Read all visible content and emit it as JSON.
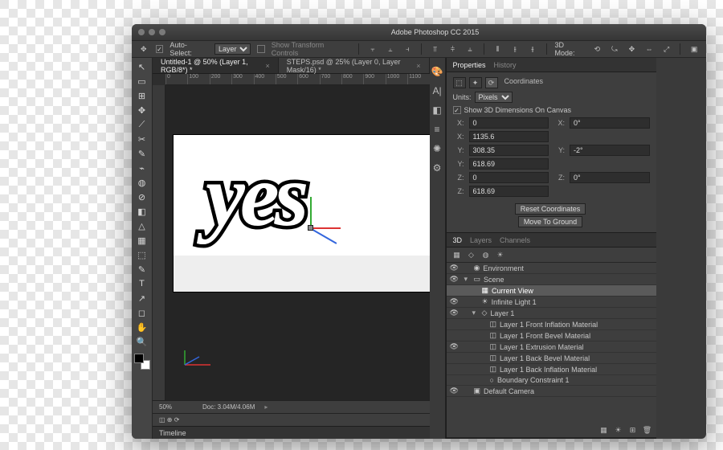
{
  "window": {
    "title": "Adobe Photoshop CC 2015"
  },
  "options": {
    "move_icon": "✥",
    "auto_select_label": "Auto-Select:",
    "auto_select_checked": true,
    "auto_select_mode": "Layer",
    "transform_label": "Show Transform Controls",
    "transform_checked": false,
    "mode_3d_label": "3D Mode:"
  },
  "tabs": [
    {
      "label": "Untitled-1 @ 50% (Layer 1, RGB/8*) *",
      "active": true
    },
    {
      "label": "STEPS.psd @ 25% (Layer 0, Layer Mask/16) *",
      "active": false
    }
  ],
  "ruler": [
    "0",
    "100",
    "200",
    "300",
    "400",
    "500",
    "600",
    "700",
    "800",
    "900",
    "1000",
    "1100"
  ],
  "canvas": {
    "text": "yes"
  },
  "status": {
    "zoom": "50%",
    "doc": "Doc: 3.04M/4.06M"
  },
  "timeline": {
    "label": "Timeline",
    "mode_icons": "◫ ⊕ ⟳"
  },
  "strip_icons": [
    "🎨",
    "A|",
    "◧",
    "≡",
    "✺",
    "⚙"
  ],
  "properties": {
    "tab_properties": "Properties",
    "tab_history": "History",
    "header_icons": [
      "⬚",
      "✦",
      "⟳"
    ],
    "header_label": "Coordinates",
    "units_label": "Units:",
    "units_value": "Pixels",
    "show_3d_label": "Show 3D Dimensions On Canvas",
    "show_3d_checked": true,
    "X_label": "X:",
    "X_val": "0",
    "X_rot_label": "X:",
    "X_rot": "0°",
    "X2_label": "X:",
    "X2_val": "1135.6",
    "Y_label": "Y:",
    "Y_val": "308.35",
    "Y_rot_label": "Y:",
    "Y_rot": "-2°",
    "Y2_label": "Y:",
    "Y2_val": "618.69",
    "Z_label": "Z:",
    "Z_val": "0",
    "Z_rot_label": "Z:",
    "Z_rot": "0°",
    "Z2_label": "Z:",
    "Z2_val": "618.69",
    "reset_btn": "Reset Coordinates",
    "ground_btn": "Move To Ground"
  },
  "panel3d": {
    "tab_3d": "3D",
    "tab_layers": "Layers",
    "tab_channels": "Channels",
    "rows": [
      {
        "indent": 0,
        "eye": true,
        "twisty": "",
        "icon": "◉",
        "label": "Environment"
      },
      {
        "indent": 0,
        "eye": true,
        "twisty": "▾",
        "icon": "▭",
        "label": "Scene"
      },
      {
        "indent": 1,
        "eye": "",
        "twisty": "",
        "icon": "▦",
        "label": "Current View",
        "sel": true
      },
      {
        "indent": 1,
        "eye": true,
        "twisty": "",
        "icon": "☀",
        "label": "Infinite Light 1"
      },
      {
        "indent": 1,
        "eye": true,
        "twisty": "▾",
        "icon": "◇",
        "label": "Layer 1"
      },
      {
        "indent": 2,
        "eye": "",
        "twisty": "",
        "icon": "◫",
        "label": "Layer 1 Front Inflation Material"
      },
      {
        "indent": 2,
        "eye": "",
        "twisty": "",
        "icon": "◫",
        "label": "Layer 1 Front Bevel Material"
      },
      {
        "indent": 2,
        "eye": true,
        "twisty": "",
        "icon": "◫",
        "label": "Layer 1 Extrusion Material"
      },
      {
        "indent": 2,
        "eye": "",
        "twisty": "",
        "icon": "◫",
        "label": "Layer 1 Back Bevel Material"
      },
      {
        "indent": 2,
        "eye": "",
        "twisty": "",
        "icon": "◫",
        "label": "Layer 1 Back Inflation Material"
      },
      {
        "indent": 2,
        "eye": "",
        "twisty": "",
        "icon": "○",
        "label": "Boundary Constraint 1"
      },
      {
        "indent": 0,
        "eye": true,
        "twisty": "",
        "icon": "▣",
        "label": "Default Camera"
      }
    ]
  },
  "tools": [
    "↖",
    "▭",
    "⊞",
    "✥",
    "⟋",
    "✂",
    "✎",
    "⌁",
    "◍",
    "⊘",
    "◧",
    "△",
    "▦",
    "⬚",
    "✎",
    "T",
    "↗",
    "◻",
    "✋",
    "🔍"
  ]
}
